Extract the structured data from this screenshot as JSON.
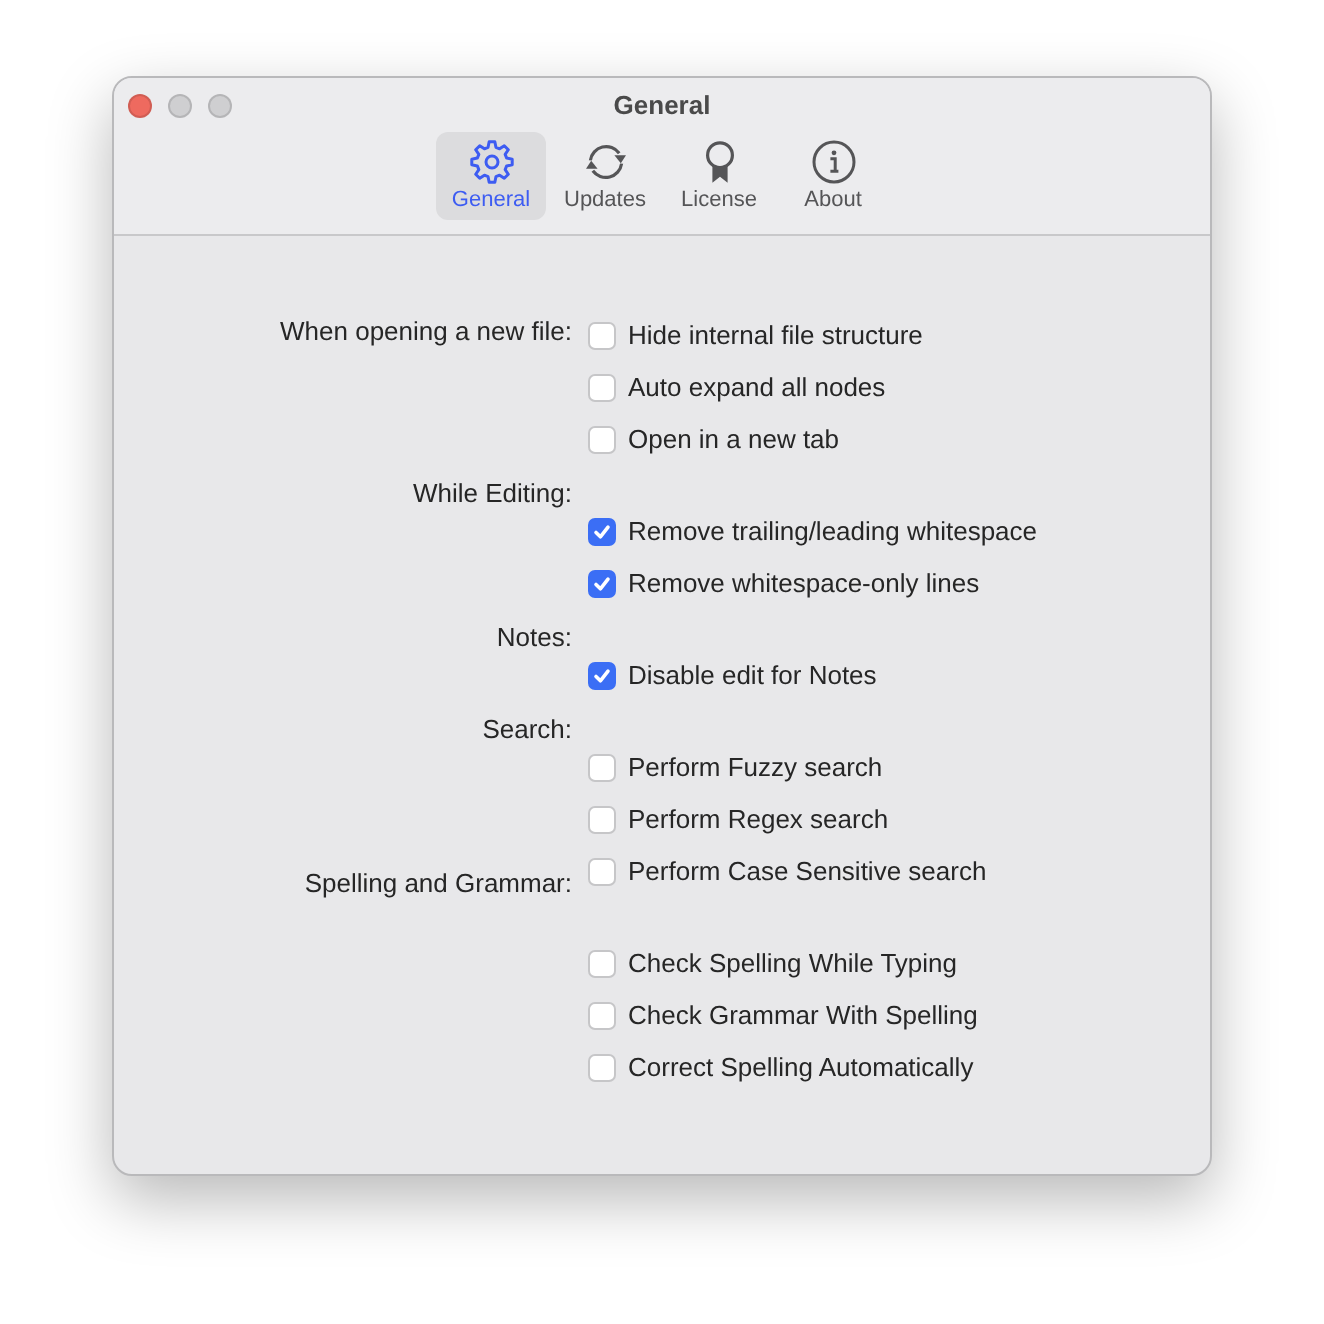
{
  "window": {
    "title": "General",
    "buttons": [
      {
        "kind": "close",
        "disabled": false
      },
      {
        "kind": "minimize",
        "disabled": true
      },
      {
        "kind": "zoom",
        "disabled": true
      }
    ]
  },
  "tabs": [
    {
      "label": "General",
      "selected": true
    },
    {
      "label": "Updates",
      "selected": false
    },
    {
      "label": "License",
      "selected": false
    },
    {
      "label": "About",
      "selected": false
    }
  ],
  "sections": [
    {
      "label": "When opening a new file:",
      "kind": "inline",
      "options": [
        {
          "label": "Hide internal file structure",
          "checked": false
        },
        {
          "label": "Auto expand all nodes",
          "checked": false
        },
        {
          "label": "Open in a new tab",
          "checked": false
        }
      ]
    },
    {
      "label": "While Editing:",
      "kind": "stacked",
      "options": [
        {
          "label": "Remove trailing/leading whitespace",
          "checked": true
        },
        {
          "label": "Remove whitespace-only lines",
          "checked": true
        }
      ]
    },
    {
      "label": "Notes:",
      "kind": "stacked",
      "options": [
        {
          "label": "Disable edit for Notes",
          "checked": true
        }
      ]
    },
    {
      "label": "Search:",
      "kind": "stacked",
      "options": [
        {
          "label": "Perform Fuzzy search",
          "checked": false
        },
        {
          "label": "Perform Regex search",
          "checked": false
        },
        {
          "label": "Perform Case Sensitive search",
          "checked": false
        }
      ]
    },
    {
      "label": "Spelling and Grammar:",
      "kind": "hanging",
      "options": [
        {
          "label": "Check Spelling While Typing",
          "checked": false
        },
        {
          "label": "Check Grammar With Spelling",
          "checked": false
        },
        {
          "label": "Correct Spelling Automatically",
          "checked": false
        }
      ]
    }
  ]
}
